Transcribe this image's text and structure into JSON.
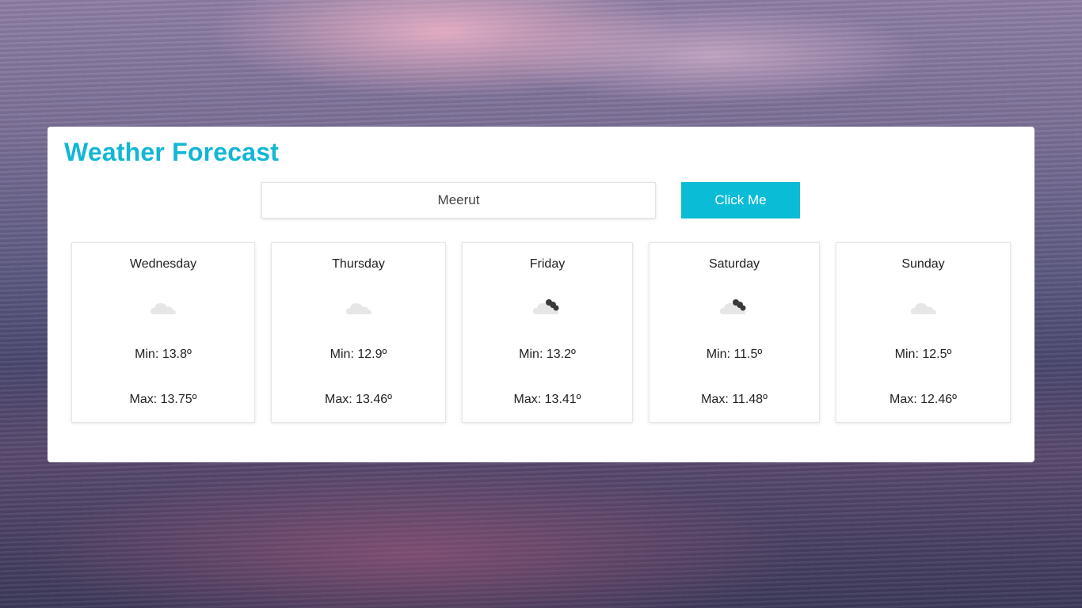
{
  "header": {
    "title": "Weather Forecast"
  },
  "search": {
    "value": "Meerut"
  },
  "actions": {
    "button_label": "Click Me"
  },
  "forecast": [
    {
      "day": "Wednesday",
      "icon": "cloud-icon",
      "min": "Min: 13.8º",
      "max": "Max: 13.75º"
    },
    {
      "day": "Thursday",
      "icon": "cloud-icon",
      "min": "Min: 12.9º",
      "max": "Max: 13.46º"
    },
    {
      "day": "Friday",
      "icon": "broken-clouds-icon",
      "min": "Min: 13.2º",
      "max": "Max: 13.41º"
    },
    {
      "day": "Saturday",
      "icon": "broken-clouds-icon",
      "min": "Min: 11.5º",
      "max": "Max: 11.48º"
    },
    {
      "day": "Sunday",
      "icon": "cloud-icon",
      "min": "Min: 12.5º",
      "max": "Max: 12.46º"
    }
  ],
  "colors": {
    "accent": "#12b6d4",
    "button": "#0bbcd6"
  }
}
